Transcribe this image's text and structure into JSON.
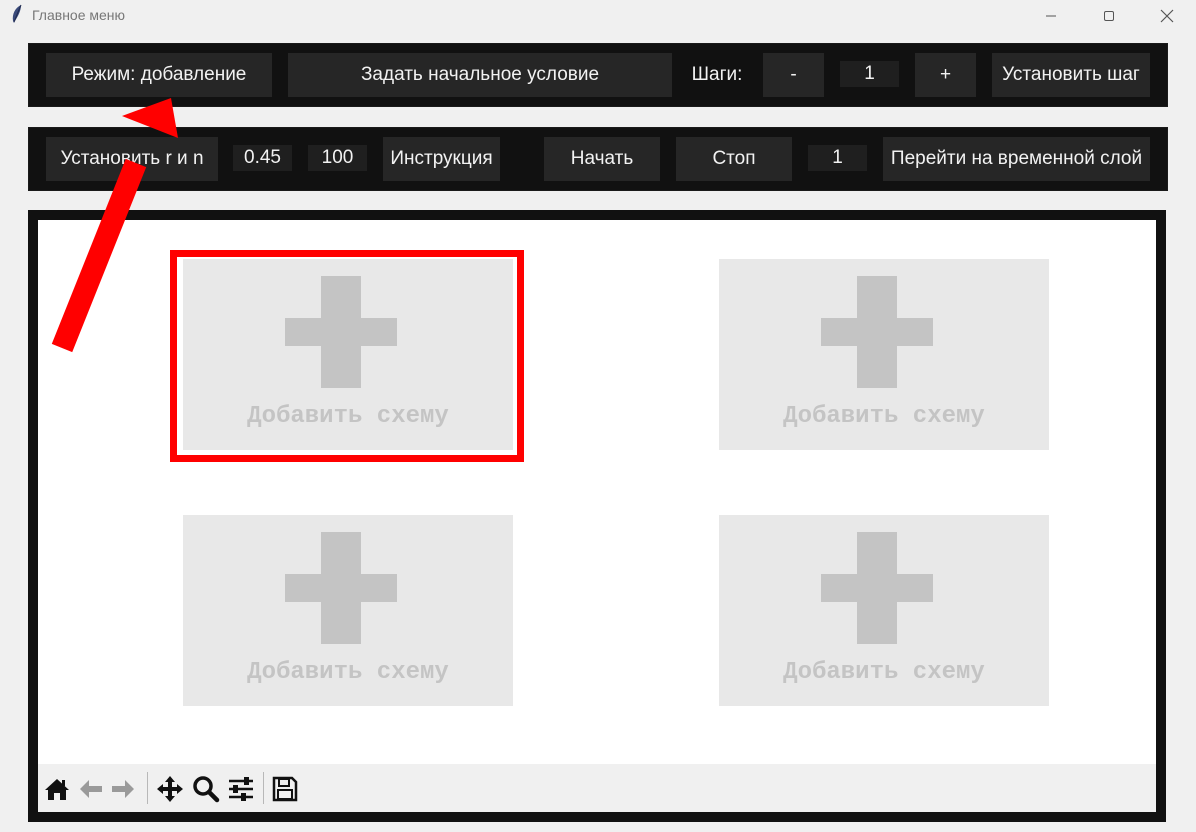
{
  "window": {
    "title": "Главное меню"
  },
  "toolbar1": {
    "mode_button": "Режим: добавление",
    "initial_condition_button": "Задать начальное условие",
    "steps_label": "Шаги:",
    "minus_button": "-",
    "steps_value": "1",
    "plus_button": "+",
    "set_step_button": "Установить шаг"
  },
  "toolbar2": {
    "set_rn_button": "Установить r и n",
    "r_value": "0.45",
    "n_value": "100",
    "instruction_button": "Инструкция",
    "start_button": "Начать",
    "stop_button": "Стоп",
    "layer_value": "1",
    "goto_layer_button": "Перейти на временной слой"
  },
  "schemes": [
    {
      "label": "Добавить схему",
      "highlighted": true
    },
    {
      "label": "Добавить схему",
      "highlighted": false
    },
    {
      "label": "Добавить схему",
      "highlighted": false
    },
    {
      "label": "Добавить схему",
      "highlighted": false
    }
  ],
  "plot_toolbar": {
    "tools": [
      "home-icon",
      "back-icon",
      "forward-icon",
      "pan-icon",
      "zoom-icon",
      "configure-subplots-icon",
      "save-icon"
    ]
  },
  "colors": {
    "panel_dark": "#111111",
    "button_bg": "#262626",
    "highlight": "#ff0000",
    "annotation_arrow": "#ff0000",
    "tile_bg": "#e8e8e8",
    "tile_fg": "#c4c4c4"
  }
}
